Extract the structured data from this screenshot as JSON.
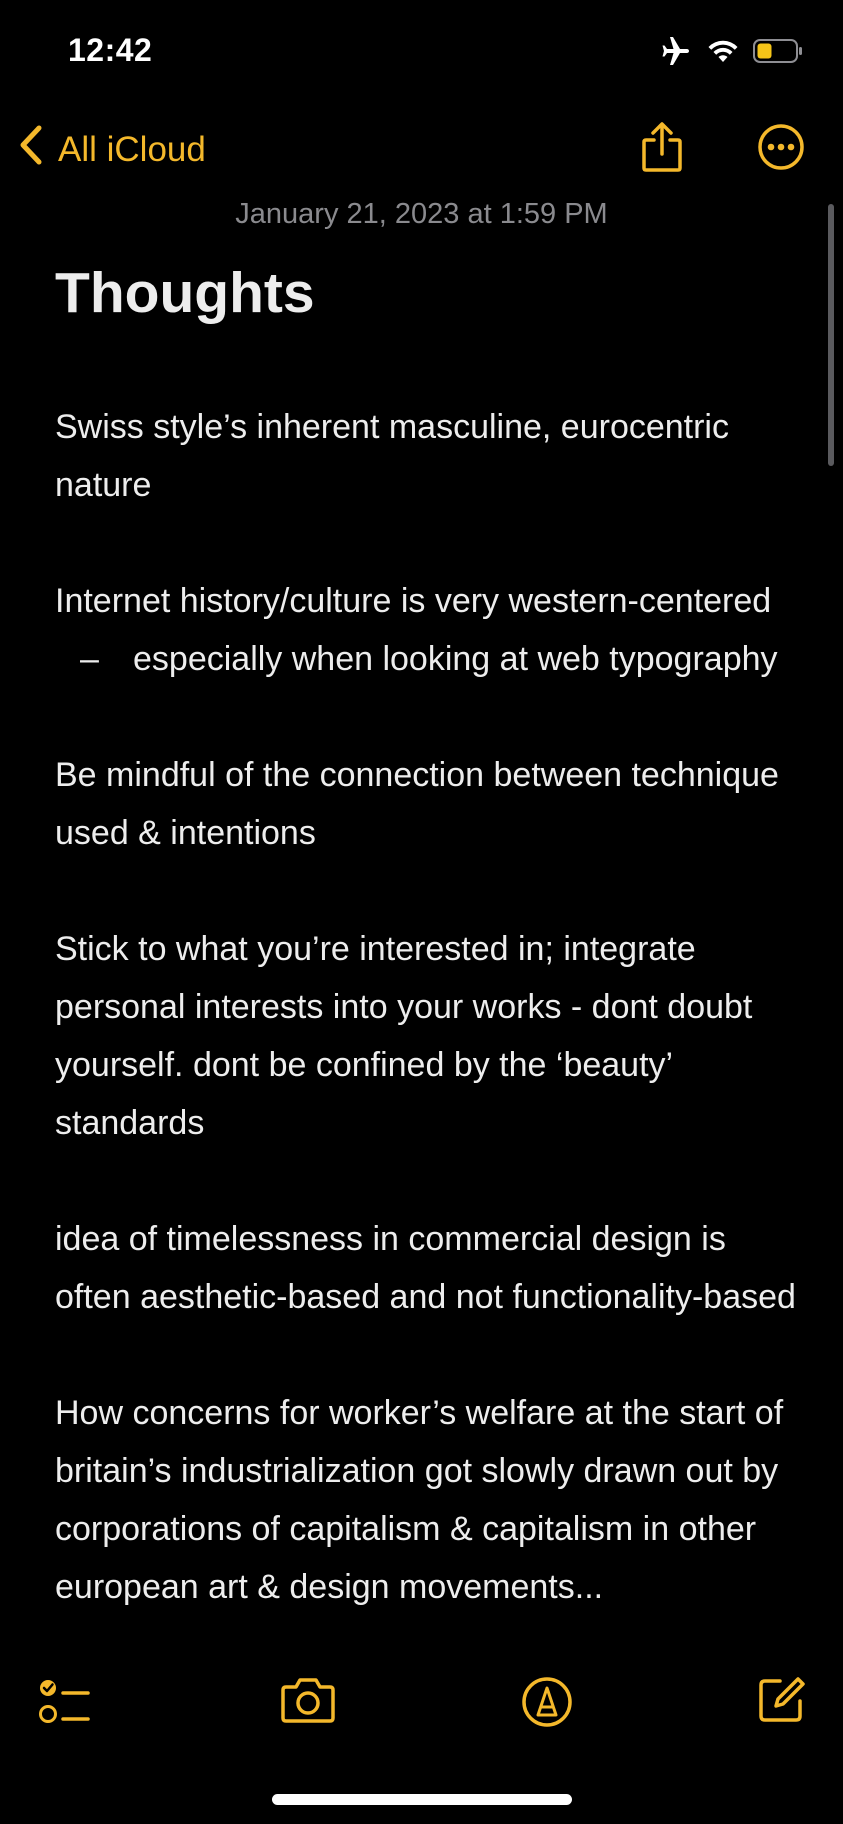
{
  "status_bar": {
    "time": "12:42",
    "icons": [
      "airplane-icon",
      "wifi-icon",
      "battery-icon"
    ],
    "battery_color": "#f5c518"
  },
  "nav": {
    "back_label": "All iCloud",
    "back_icon": "chevron-left-icon",
    "share_icon": "share-icon",
    "more_icon": "ellipsis-circle-icon",
    "accent_color": "#f4b82b"
  },
  "note": {
    "date": "January 21, 2023 at 1:59 PM",
    "title": "Thoughts",
    "blocks": {
      "p1": "Swiss style’s inherent masculine, eurocentric nature",
      "p2": "Internet history/culture is very western-centered",
      "b1_dash": "–",
      "b1": "especially when looking at web typography",
      "p3": "Be mindful of the connection between technique used & intentions",
      "p4": "Stick to what you’re interested in; integrate personal interests into your works - dont doubt yourself. dont be confined by the ‘beauty’ standards",
      "p5": "idea of timelessness in commercial design is often aesthetic-based and not functionality-based",
      "p6": "How concerns for worker’s welfare at the start of britain’s industrialization got slowly drawn out by corporations of capitalism & capitalism in other european art & design movements..."
    }
  },
  "toolbar": {
    "items": [
      "checklist-icon",
      "camera-icon",
      "markup-icon",
      "compose-icon"
    ]
  }
}
